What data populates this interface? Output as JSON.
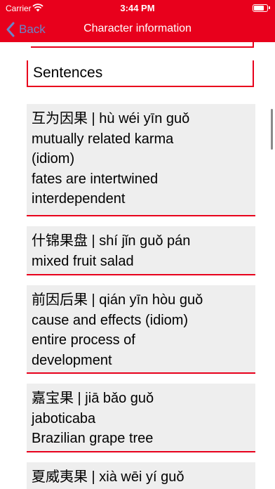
{
  "status_bar": {
    "carrier": "Carrier",
    "time": "3:44 PM",
    "wifi_icon": "wifi-icon",
    "battery_icon": "battery-icon"
  },
  "nav": {
    "back_label": "Back",
    "title": "Character information",
    "back_icon": "chevron-left-icon"
  },
  "section": {
    "title": "Sentences"
  },
  "sentences": [
    {
      "lines": [
        "互为因果 | hù wéi yīn guǒ",
        "mutually related karma",
        "(idiom)",
        "fates are intertwined",
        "interdependent"
      ]
    },
    {
      "lines": [
        "什锦果盘 | shí jǐn guǒ pán",
        "mixed fruit salad"
      ]
    },
    {
      "lines": [
        "前因后果 | qián yīn hòu guǒ",
        "cause and effects (idiom)",
        "entire process of",
        "development"
      ]
    },
    {
      "lines": [
        "嘉宝果 | jiā bǎo guǒ",
        "jaboticaba",
        "Brazilian grape tree"
      ]
    },
    {
      "lines": [
        "夏威夷果 | xià wēi yí guǒ"
      ]
    }
  ],
  "colors": {
    "accent": "#e8001c",
    "card_background": "#eeeeee",
    "back_button": "#6a86c8"
  }
}
